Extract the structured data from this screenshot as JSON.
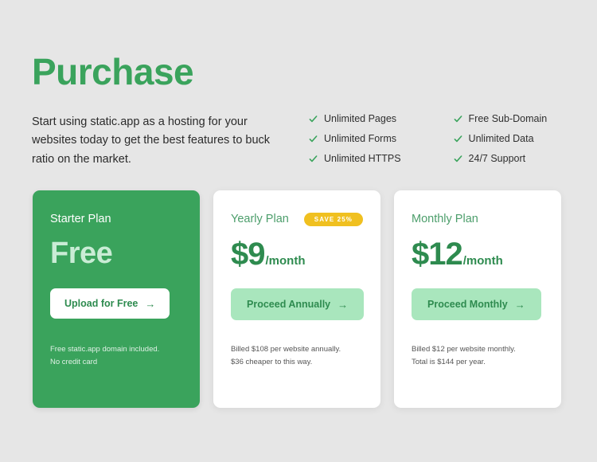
{
  "hero": {
    "title": "Purchase",
    "intro": "Start using static.app as a hosting for your websites today to get the best features to buck ratio on the market.",
    "title_color": "#3aa35c"
  },
  "features": {
    "icon": "check-icon",
    "columns": [
      {
        "items": [
          "Unlimited Pages",
          "Unlimited Forms",
          "Unlimited HTTPS"
        ]
      },
      {
        "items": [
          "Free Sub-Domain",
          "Unlimited Data",
          "24/7 Support"
        ]
      }
    ]
  },
  "plans": [
    {
      "name": "Starter Plan",
      "price_main": "Free",
      "price_period": "",
      "badge": "",
      "cta_label": "Upload for Free",
      "cta_arrow": "→",
      "footnote_lines": [
        "Free static.app domain included.",
        "No credit card"
      ],
      "style": "green",
      "bg_color": "#3aa35c",
      "price_color": "#c9ecd5",
      "cta_bg": "#ffffff",
      "cta_color": "#2e8b4f"
    },
    {
      "name": "Yearly Plan",
      "price_main": "$9",
      "price_period": "/month",
      "badge": "SAVE 25%",
      "cta_label": "Proceed Annually",
      "cta_arrow": "→",
      "footnote_lines": [
        "Billed $108 per website annually.",
        "$36 cheaper to this way."
      ],
      "style": "white",
      "bg_color": "#ffffff",
      "price_color": "#2e8b4f",
      "cta_bg": "#a9e6bd",
      "cta_color": "#2e8b4f",
      "badge_bg": "#f0c020"
    },
    {
      "name": "Monthly Plan",
      "price_main": "$12",
      "price_period": "/month",
      "badge": "",
      "cta_label": "Proceed Monthly",
      "cta_arrow": "→",
      "footnote_lines": [
        "Billed $12 per website monthly.",
        "Total is $144 per year."
      ],
      "style": "white",
      "bg_color": "#ffffff",
      "price_color": "#2e8b4f",
      "cta_bg": "#a9e6bd",
      "cta_color": "#2e8b4f"
    }
  ],
  "theme": {
    "page_bg": "#e6e6e6",
    "accent": "#3aa35c",
    "accent_dark": "#2e8b4f",
    "mint": "#a9e6bd",
    "gold": "#f0c020"
  }
}
